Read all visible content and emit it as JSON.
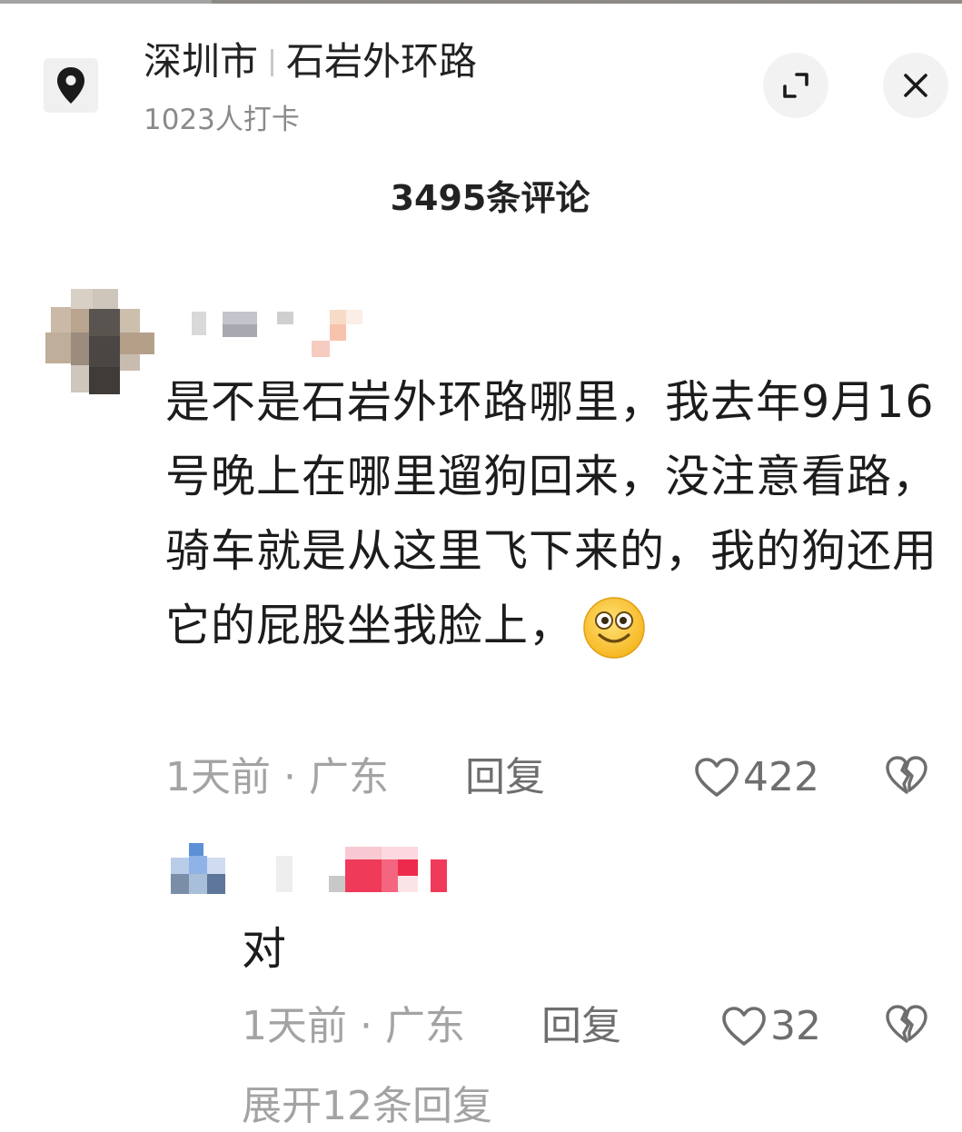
{
  "location": {
    "city": "深圳市",
    "road": "石岩外环路",
    "checkins": "1023人打卡",
    "icon": "location-pin-icon"
  },
  "header": {
    "expand_icon": "expand-icon",
    "close_icon": "close-icon"
  },
  "comments_count": "3495条评论",
  "comment": {
    "text": "是不是石岩外环路哪里，我去年9月16号晚上在哪里遛狗回来，没注意看路，骑车就是从这里飞下来的，我的狗还用它的屁股坐我脸上，",
    "emoji": "smiling-face-emoji",
    "time": "1天前",
    "region": "广东",
    "reply_label": "回复",
    "likes": "422"
  },
  "reply": {
    "text": "对",
    "time": "1天前",
    "region": "广东",
    "reply_label": "回复",
    "likes": "32"
  },
  "more_replies_partial": "展开12条回复",
  "colors": {
    "text_primary": "#222222",
    "text_secondary": "#a3a3a3",
    "button_bg": "#f2f2f2"
  }
}
